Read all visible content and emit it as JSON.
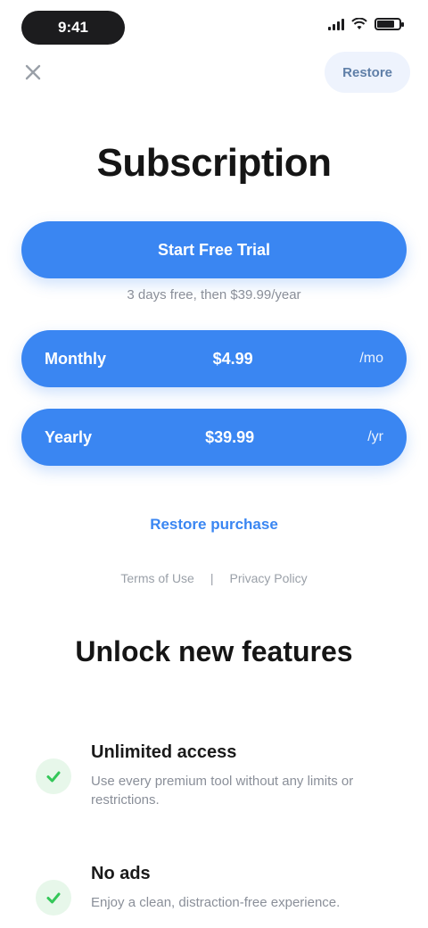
{
  "status_bar": {
    "time": "9:41"
  },
  "nav": {
    "close_icon": "close-icon",
    "restore_label": "Restore"
  },
  "title": "Subscription",
  "plans": [
    {
      "label": "Start Free Trial"
    },
    {
      "label": "Monthly",
      "price": "$4.99",
      "period": "/mo"
    },
    {
      "label": "Yearly",
      "price": "$39.99",
      "period": "/yr"
    }
  ],
  "trial_note": "3 days free, then $39.99/year",
  "more_link": "Restore purchase",
  "legal": {
    "terms": "Terms of Use",
    "separator": "|",
    "privacy": "Privacy Policy"
  },
  "features_title": "Unlock new features",
  "features": [
    {
      "title": "Unlimited access",
      "description": "Use every premium tool without any limits or restrictions."
    },
    {
      "title": "No ads",
      "description": "Enjoy a clean, distraction-free experience."
    }
  ],
  "colors": {
    "accent": "#3a86f2",
    "check_bg": "#e7f7ea",
    "check": "#34c759"
  }
}
